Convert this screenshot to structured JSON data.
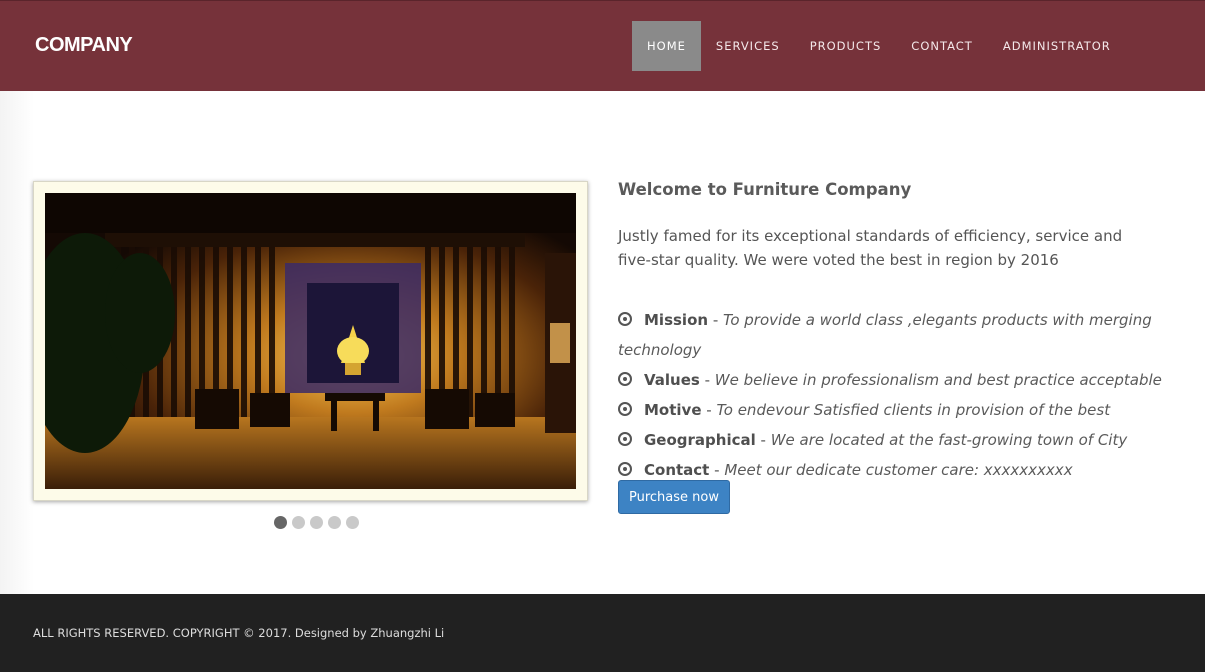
{
  "header": {
    "brand": "COMPANY",
    "nav": [
      {
        "label": "HOME",
        "active": true
      },
      {
        "label": "SERVICES",
        "active": false
      },
      {
        "label": "PRODUCTS",
        "active": false
      },
      {
        "label": "CONTACT",
        "active": false
      },
      {
        "label": "ADMINISTRATOR",
        "active": false
      }
    ]
  },
  "slider": {
    "slide_count": 5,
    "active_index": 0
  },
  "content": {
    "welcome": "Welcome to Furniture Company",
    "intro": "Justly famed for its exceptional standards of efficiency, service and five-star quality. We were voted the best in region by 2016",
    "features": [
      {
        "name": "Mission",
        "sep": " - ",
        "desc": "To provide a world class ,elegants products with merging technology"
      },
      {
        "name": "Values",
        "sep": " - ",
        "desc": "We believe in professionalism and best practice acceptable"
      },
      {
        "name": "Motive",
        "sep": " - ",
        "desc": "To endevour Satisfied clients in provision of the best"
      },
      {
        "name": "Geographical",
        "sep": " - ",
        "desc": "We are located at the fast-growing town of City"
      },
      {
        "name": "Contact",
        "sep": " - ",
        "desc": "Meet our dedicate customer care: xxxxxxxxxx"
      }
    ],
    "purchase_label": "Purchase now"
  },
  "footer": {
    "text": "ALL RIGHTS RESERVED. COPYRIGHT © 2017. Designed by Zhuangzhi Li"
  },
  "colors": {
    "header_bg": "#76323a",
    "nav_active_bg": "#8a8a8a",
    "button_bg": "#3d83c4",
    "footer_bg": "#212121"
  }
}
